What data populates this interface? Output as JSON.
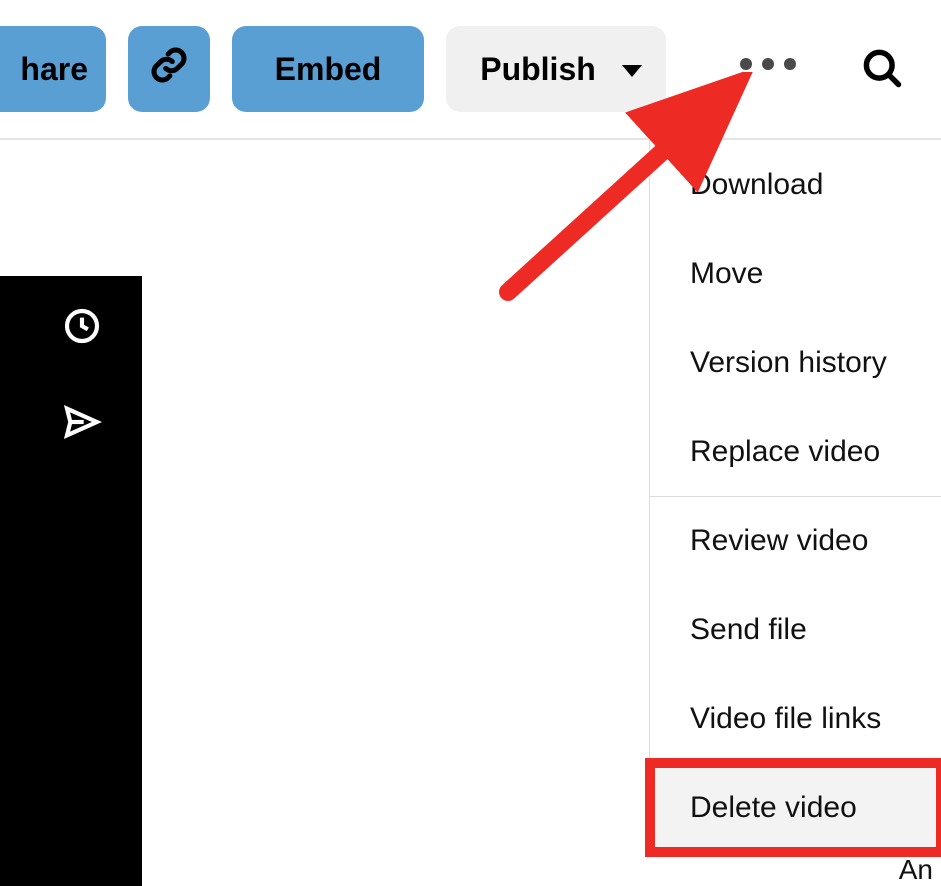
{
  "toolbar": {
    "share_label": "hare",
    "embed_label": "Embed",
    "publish_label": "Publish"
  },
  "menu": {
    "items": [
      {
        "label": "Download"
      },
      {
        "label": "Move"
      },
      {
        "label": "Version history"
      },
      {
        "label": "Replace video"
      },
      {
        "label": "Review video"
      },
      {
        "label": "Send file"
      },
      {
        "label": "Video file links"
      },
      {
        "label": "Delete video"
      }
    ],
    "tail_fragment": "An"
  },
  "annotation": {
    "arrow_color": "#ee2a24",
    "highlight_index": 7
  }
}
